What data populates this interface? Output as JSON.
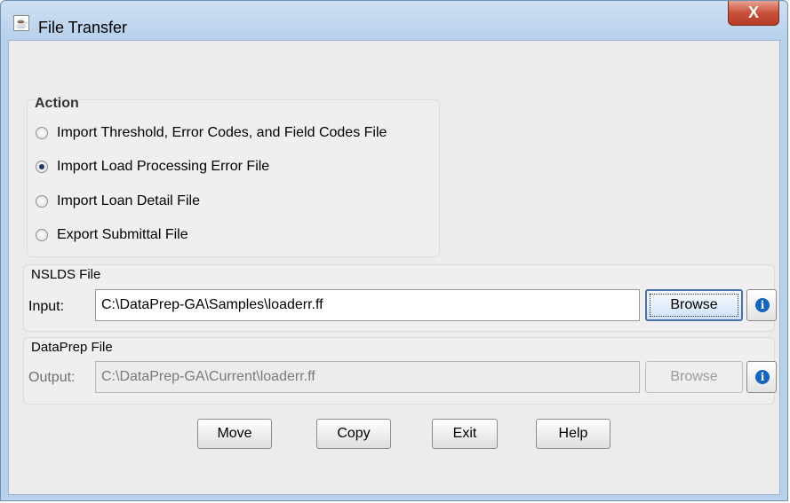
{
  "window": {
    "title": "File Transfer",
    "app_icon": "java-app-icon",
    "close_label": "X"
  },
  "action": {
    "label": "Action",
    "options": [
      {
        "label": "Import Threshold, Error Codes, and Field Codes File",
        "checked": false
      },
      {
        "label": "Import Load Processing Error File",
        "checked": true
      },
      {
        "label": "Import Loan Detail File",
        "checked": false
      },
      {
        "label": "Export Submittal File",
        "checked": false
      }
    ]
  },
  "nslds": {
    "label": "NSLDS File",
    "input_label": "Input:",
    "input_value": "C:\\DataPrep-GA\\Samples\\loaderr.ff",
    "browse_label": "Browse",
    "info_icon": "info-icon"
  },
  "dataprep": {
    "label": "DataPrep File",
    "output_label": "Output:",
    "output_value": "C:\\DataPrep-GA\\Current\\loaderr.ff",
    "browse_label": "Browse",
    "info_icon": "info-icon"
  },
  "buttons": {
    "move": "Move",
    "copy": "Copy",
    "exit": "Exit",
    "help": "Help"
  },
  "colors": {
    "info_blue": "#1565c0",
    "title_gradient": "#b9d1ec",
    "close_red": "#c9503a"
  }
}
